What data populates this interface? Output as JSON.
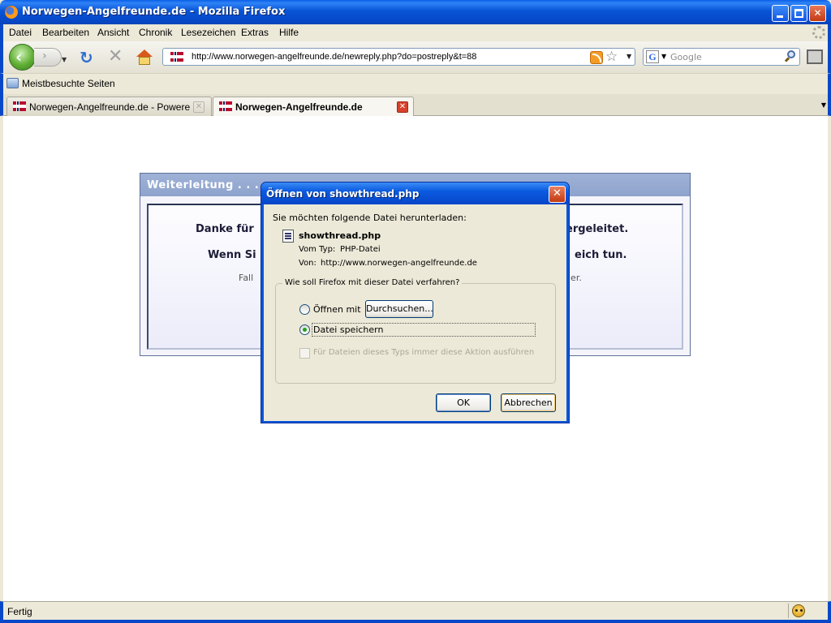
{
  "window": {
    "title": "Norwegen-Angelfreunde.de - Mozilla Firefox",
    "controls": {
      "minimize": "_",
      "maximize": "□",
      "close": "✕"
    }
  },
  "menu": {
    "items": [
      "Datei",
      "Bearbeiten",
      "Ansicht",
      "Chronik",
      "Lesezeichen",
      "Extras",
      "Hilfe"
    ]
  },
  "navbar": {
    "back_glyph": "‹",
    "forward_glyph": "›",
    "dropdown_glyph": "▼",
    "reload_glyph": "↻",
    "stop_glyph": "✕",
    "url": "http://www.norwegen-angelfreunde.de/newreply.php?do=postreply&t=88",
    "star_glyph": "☆",
    "search_placeholder": "Google",
    "search_engine_glyph": "G"
  },
  "bookmarks": {
    "items": [
      "Meistbesuchte Seiten"
    ]
  },
  "tabs": [
    {
      "label": "Norwegen-Angelfreunde.de - Powered ...",
      "active": false,
      "close": "✕"
    },
    {
      "label": "Norwegen-Angelfreunde.de",
      "active": true,
      "close": "✕"
    }
  ],
  "tab_list_glyph": "▼",
  "page": {
    "redirect_title": "Weiterleitung . . .",
    "thank_left": "Danke für",
    "thank_right": "ergeleitet.",
    "wenn_left": "Wenn Si",
    "wenn_right": "eich tun.",
    "fall_left": "Fall",
    "fall_right": "ier."
  },
  "dialog": {
    "title": "Öffnen von showthread.php",
    "close": "✕",
    "intro": "Sie möchten folgende Datei herunterladen:",
    "filename": "showthread.php",
    "type_label": "Vom Typ:",
    "type_value": "PHP-Datei",
    "from_label": "Von:",
    "from_value": "http://www.norwegen-angelfreunde.de",
    "group_legend": "Wie soll Firefox mit dieser Datei verfahren?",
    "open_with_label": "Öffnen mit",
    "browse_label": "Durchsuchen...",
    "save_label": "Datei speichern",
    "always_label": "Für Dateien dieses Typs immer diese Aktion ausführen",
    "ok_label": "OK",
    "cancel_label": "Abbrechen",
    "selected_option": "Datei speichern",
    "always_checked": false
  },
  "status": {
    "text": "Fertig"
  },
  "colors": {
    "xp_title_blue": "#0854d6",
    "redirect_header": "#8ea3cc",
    "radio_checked": "#21a121"
  }
}
